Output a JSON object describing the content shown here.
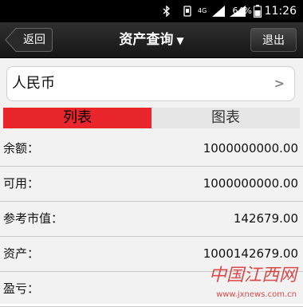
{
  "status_bar": {
    "time": "11:26",
    "battery_percent": "64%",
    "network": "4G",
    "icons": [
      "bluetooth-icon",
      "vibrate-icon",
      "signal-icon",
      "battery-icon"
    ]
  },
  "nav": {
    "back_label": "返回",
    "title": "资产查询",
    "title_arrow": "▼",
    "exit_label": "退出"
  },
  "currency": {
    "selected": "人民币"
  },
  "tabs": [
    {
      "label": "列表",
      "active": true
    },
    {
      "label": "图表",
      "active": false
    }
  ],
  "rows": [
    {
      "label": "余额：",
      "value": "1000000000.00"
    },
    {
      "label": "可用：",
      "value": "1000000000.00"
    },
    {
      "label": "参考市值：",
      "value": "142679.00"
    },
    {
      "label": "资产：",
      "value": "1000142679.00"
    },
    {
      "label": "盈亏：",
      "value": ""
    }
  ],
  "watermark": {
    "logo_text": "中国江西网",
    "url_text": "www.jxnews.com.cn"
  },
  "colors": {
    "nav_bg": "#1f1f1f",
    "active_tab": "#e8262b",
    "inactive_tab": "#e6e6e6"
  }
}
